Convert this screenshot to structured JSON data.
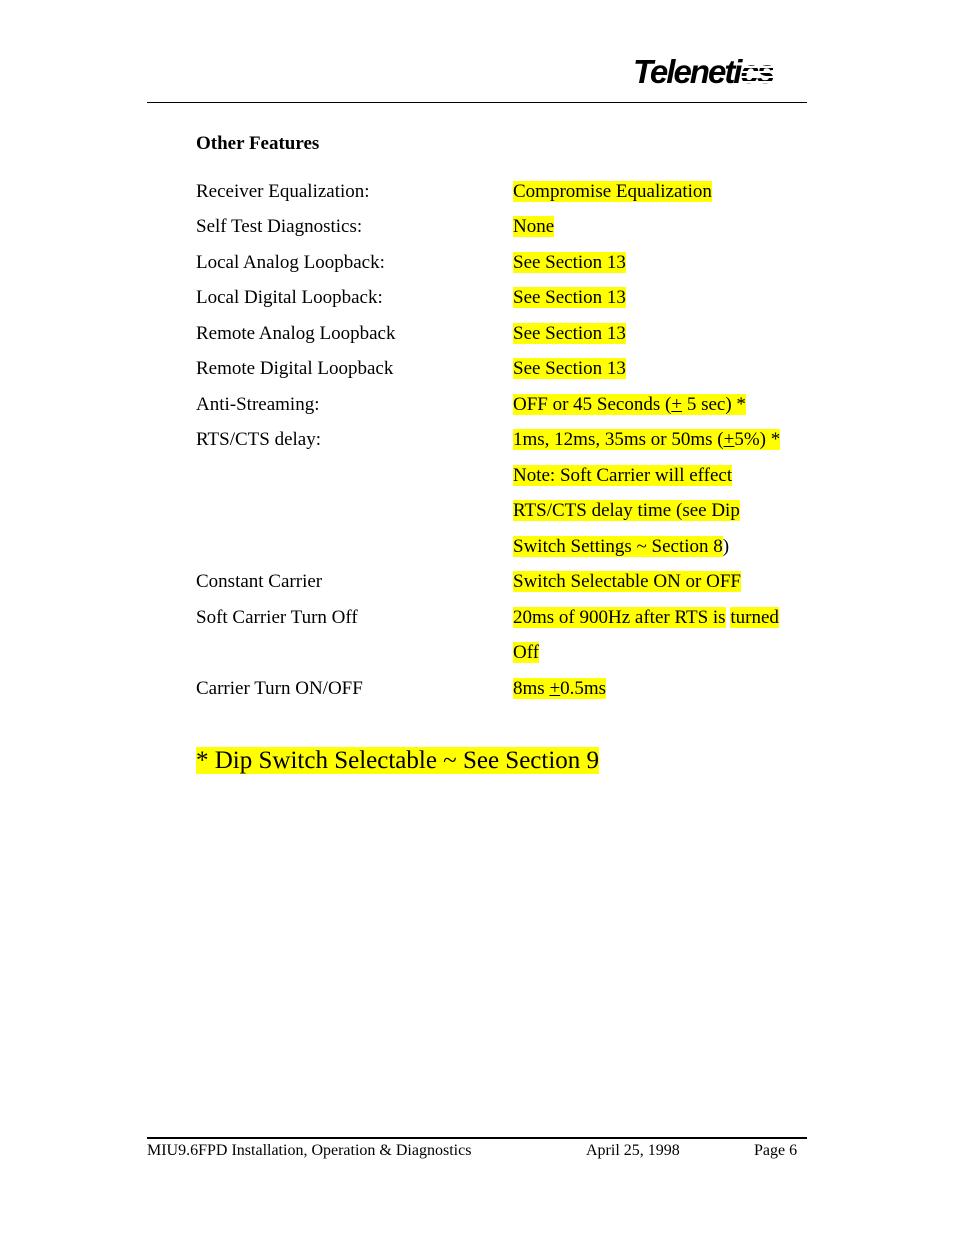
{
  "header": {
    "logo_text": "Teleneti",
    "logo_tail": "cs"
  },
  "section": {
    "title": "Other Features",
    "rows": [
      {
        "label": "Receiver Equalization:",
        "value": "Compromise Equalization"
      },
      {
        "label": "Self Test Diagnostics:",
        "value": "None"
      },
      {
        "label": "Local Analog Loopback:",
        "value": "See Section 13"
      },
      {
        "label": "Local Digital Loopback:",
        "value": "See Section 13"
      },
      {
        "label": "Remote Analog Loopback",
        "value": "See Section 13"
      },
      {
        "label": "Remote Digital Loopback",
        "value": "See Section 13"
      },
      {
        "label": "Anti-Streaming:",
        "value_pre": "OFF or 45 Seconds (",
        "value_pm": "+",
        "value_post": " 5 sec) *"
      },
      {
        "label": "RTS/CTS delay:",
        "value_pre": "1ms, 12ms, 35ms or 50ms (",
        "value_pm": "+",
        "value_post": "5%) *"
      },
      {
        "value": "Note: Soft Carrier will effect"
      },
      {
        "value": "RTS/CTS delay time (see Dip"
      },
      {
        "value_hl": "Switch Settings ~ Section 8",
        "value_tail": ")"
      },
      {
        "label": "Constant Carrier",
        "value": "Switch Selectable  ON or OFF"
      },
      {
        "label": "Soft Carrier Turn Off",
        "value_a": "20ms of  900Hz after RTS is",
        "value_b": "turned"
      },
      {
        "value": "Off"
      },
      {
        "label": "Carrier Turn ON/OFF",
        "value_pre": "8ms ",
        "value_pm": "+",
        "value_post": "0.5ms"
      }
    ]
  },
  "footnote": "* Dip Switch Selectable ~ See Section 9",
  "footer": {
    "doc_title": "MIU9.6FPD Installation, Operation & Diagnostics",
    "date": "April 25, 1998",
    "page": "Page 6"
  },
  "colors": {
    "highlight": "#ffff00"
  }
}
